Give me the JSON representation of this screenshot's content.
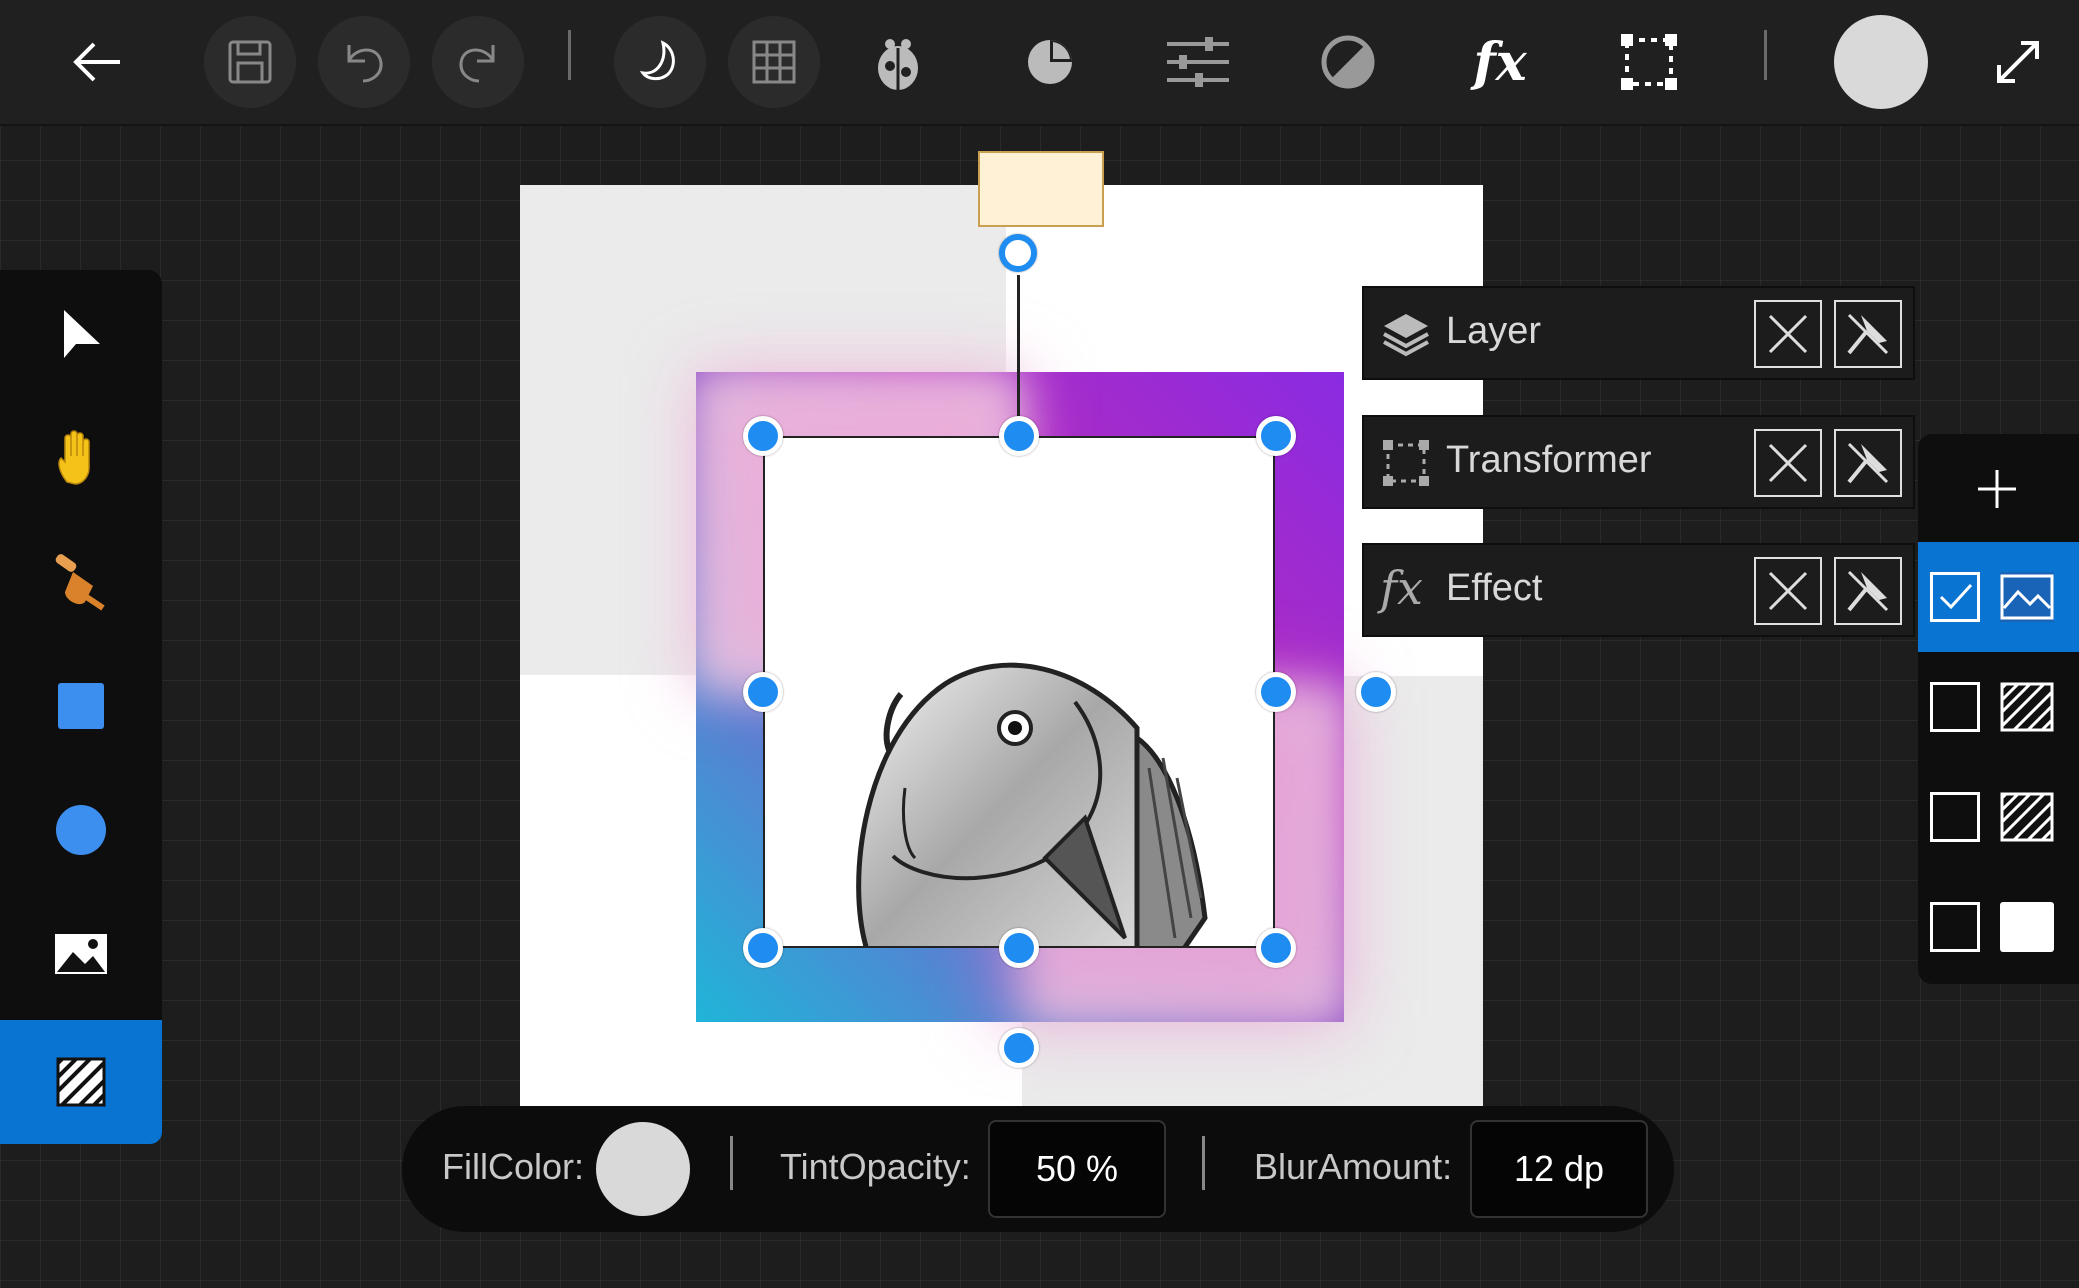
{
  "toolbar": {
    "back": "back-arrow-icon",
    "save": "save-icon",
    "undo": "undo-icon",
    "redo": "redo-icon",
    "theme": "moon-icon",
    "grid": "grid-icon",
    "debug": "bug-icon",
    "chart": "pie-chart-icon",
    "adjust": "sliders-icon",
    "contrast": "contrast-icon",
    "fx_label": "fx",
    "transform": "transform-icon",
    "color_swatch": "#d9d9d9",
    "expand": "expand-icon"
  },
  "tools": [
    {
      "name": "select-tool",
      "icon": "pointer-arrow-icon"
    },
    {
      "name": "pan-tool",
      "icon": "hand-icon"
    },
    {
      "name": "brush-tool",
      "icon": "brush-icon"
    },
    {
      "name": "rectangle-tool",
      "icon": "square-icon"
    },
    {
      "name": "ellipse-tool",
      "icon": "circle-icon"
    },
    {
      "name": "image-tool",
      "icon": "image-icon"
    },
    {
      "name": "acrylic-tool",
      "icon": "hatch-icon",
      "active": true
    }
  ],
  "panels": {
    "layer": {
      "title": "Layer"
    },
    "transformer": {
      "title": "Transformer"
    },
    "effect": {
      "title": "Effect",
      "icon_text": "fx"
    }
  },
  "layers": {
    "add_icon": "plus-icon",
    "rows": [
      {
        "checked": true,
        "thumb": "image",
        "active": true
      },
      {
        "checked": false,
        "thumb": "hatch"
      },
      {
        "checked": false,
        "thumb": "hatch"
      },
      {
        "checked": false,
        "thumb": "white"
      }
    ]
  },
  "properties": {
    "fill_label": "FillColor:",
    "fill_color": "#d9d9d9",
    "tint_label": "TintOpacity:",
    "tint_value": "50 %",
    "blur_label": "BlurAmount:",
    "blur_value": "12 dp"
  },
  "colors": {
    "accent": "#0a74d3",
    "handle": "#1e8cf0",
    "gradient_start": "#22b0d8",
    "gradient_end": "#9b2bd8"
  }
}
